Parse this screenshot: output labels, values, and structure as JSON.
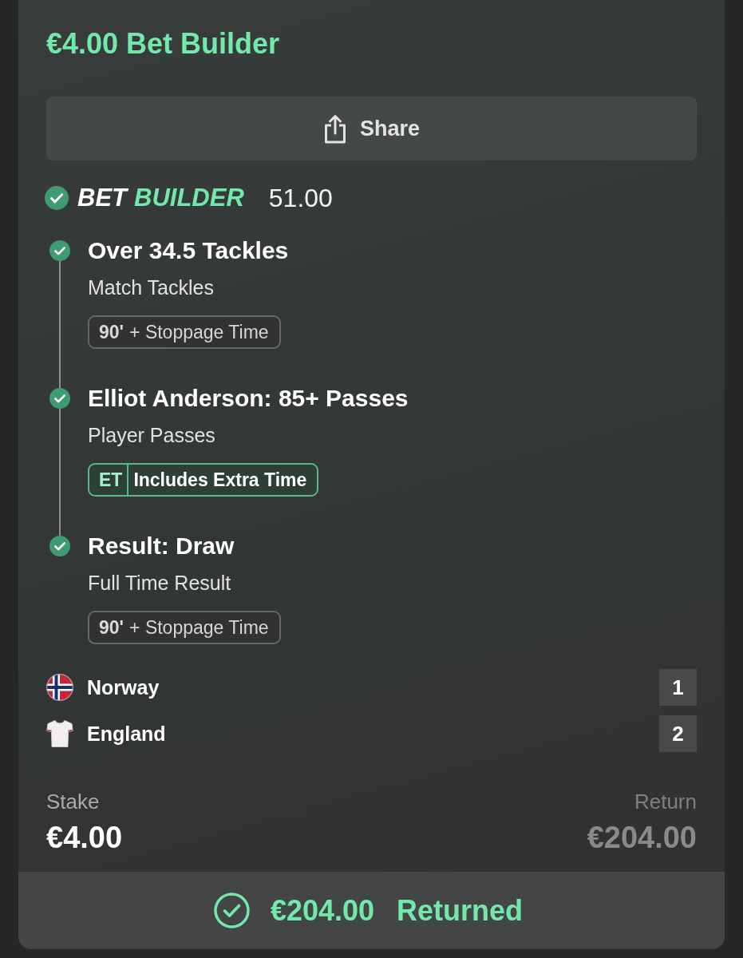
{
  "bet_title": "€4.00 Bet Builder",
  "share_button": {
    "label": "Share"
  },
  "bet_builder": {
    "prefix": "BET",
    "highlight": "BUILDER",
    "odds": "51.00",
    "won": true
  },
  "legs": [
    {
      "title": "Over 34.5 Tackles",
      "market": "Match Tackles",
      "won": true,
      "tag": {
        "kind": "stoppage",
        "badge": "90'",
        "label": "+ Stoppage Time"
      }
    },
    {
      "title": "Elliot Anderson: 85+ Passes",
      "market": "Player Passes",
      "won": true,
      "tag": {
        "kind": "extra_time",
        "badge": "ET",
        "label": "Includes Extra Time"
      }
    },
    {
      "title": "Result: Draw",
      "market": "Full Time Result",
      "won": true,
      "tag": {
        "kind": "stoppage",
        "badge": "90'",
        "label": "+ Stoppage Time"
      }
    }
  ],
  "teams": [
    {
      "kind": "flag",
      "name": "Norway",
      "score": "1"
    },
    {
      "kind": "shirt",
      "name": "England",
      "score": "2"
    }
  ],
  "stake": {
    "label": "Stake",
    "amount": "€4.00"
  },
  "return": {
    "label": "Return",
    "amount": "€204.00"
  },
  "status_bar": {
    "kind": "returned",
    "amount": "€204.00",
    "label": "Returned"
  }
}
